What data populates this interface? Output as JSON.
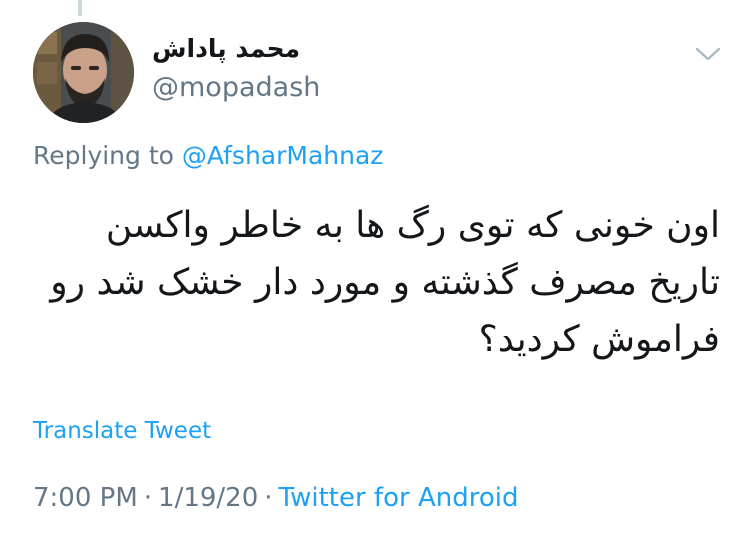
{
  "tweet": {
    "author_name": "محمد پاداش",
    "author_handle": "@mopadash",
    "reply_prefix": "Replying to",
    "reply_mention": "@AfsharMahnaz",
    "text_lines": [
      "اون خونی که توی رگ ها به خاطر واکسن",
      "تاریخ مصرف گذشته و مورد دار خشک شد رو",
      "فراموش کردید؟"
    ],
    "translate_label": "Translate Tweet",
    "time": "7:00 PM",
    "date": "1/19/20",
    "separator": "·",
    "source": "Twitter for Android"
  },
  "icons": {
    "caret": "chevron-down-icon",
    "avatar": "avatar-photo"
  },
  "colors": {
    "link": "#1da1f2",
    "secondary_text": "#657786",
    "primary_text": "#14171a",
    "thread_line": "#ccd6dd"
  }
}
